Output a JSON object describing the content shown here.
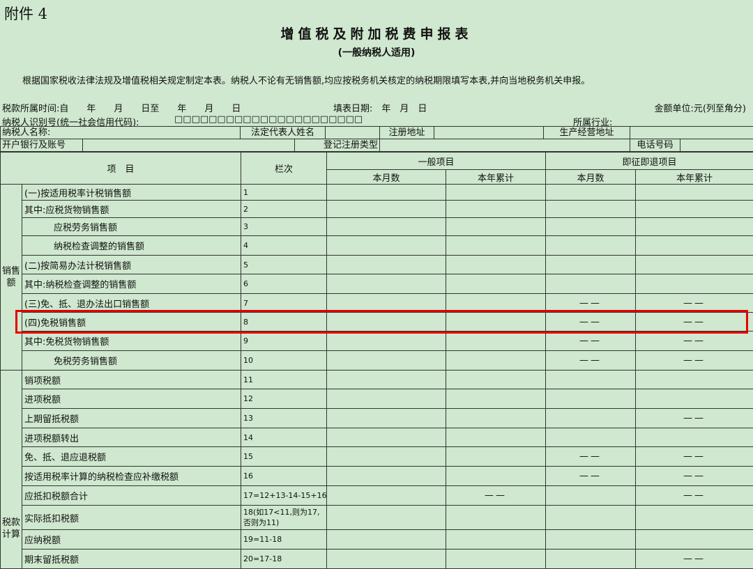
{
  "header": {
    "attachment": "附件 4",
    "title": "增值税及附加税费申报表",
    "subtitle": "(一般纳税人适用)",
    "intro": "根据国家税收法律法规及增值税相关规定制定本表。纳税人不论有无销售额,均应按税务机关核定的纳税期限填写本表,并向当地税务机关申报。"
  },
  "meta": {
    "period": "税款所属时间:自　　年　　月　　日至　　年　　月　　日",
    "fill_date": "填表日期:　年　月　日",
    "unit": "金额单位:元(列至角分)",
    "taxpayer_id": "纳税人识别号(统一社会信用代码):",
    "id_boxes": "□□□□□□□□□□□□□□□□□□□□□□",
    "industry": "所属行业:"
  },
  "info": {
    "name_label": "纳税人名称:",
    "legal_rep": "法定代表人姓名",
    "reg_address": "注册地址",
    "biz_address": "生产经营地址",
    "bank_label": "开户银行及账号",
    "reg_type": "登记注册类型",
    "phone": "电话号码"
  },
  "columns": {
    "item": "项　目",
    "seq": "栏次",
    "general": "一般项目",
    "refund": "即征即退项目",
    "month": "本月数",
    "ytd": "本年累计"
  },
  "groups": {
    "sales": "销售额",
    "tax": "税款计算"
  },
  "dash": "——",
  "rows": [
    {
      "name": "(一)按适用税率计税销售额",
      "seq": "1"
    },
    {
      "name": "其中:应税货物销售额",
      "seq": "2"
    },
    {
      "name": "应税劳务销售额",
      "seq": "3"
    },
    {
      "name": "纳税检查调整的销售额",
      "seq": "4"
    },
    {
      "name": "(二)按简易办法计税销售额",
      "seq": "5"
    },
    {
      "name": "其中:纳税检查调整的销售额",
      "seq": "6"
    },
    {
      "name": "(三)免、抵、退办法出口销售额",
      "seq": "7"
    },
    {
      "name": "(四)免税销售额",
      "seq": "8"
    },
    {
      "name": "其中:免税货物销售额",
      "seq": "9"
    },
    {
      "name": "免税劳务销售额",
      "seq": "10"
    },
    {
      "name": "销项税额",
      "seq": "11"
    },
    {
      "name": "进项税额",
      "seq": "12"
    },
    {
      "name": "上期留抵税额",
      "seq": "13"
    },
    {
      "name": "进项税额转出",
      "seq": "14"
    },
    {
      "name": "免、抵、退应退税额",
      "seq": "15"
    },
    {
      "name": "按适用税率计算的纳税检查应补缴税额",
      "seq": "16"
    },
    {
      "name": "应抵扣税额合计",
      "seq": "17=12+13-14-15+16"
    },
    {
      "name": "实际抵扣税额",
      "seq": "18(如17<11,则为17,否则为11)"
    },
    {
      "name": "应纳税额",
      "seq": "19=11-18"
    },
    {
      "name": "期末留抵税额",
      "seq": "20=17-18"
    }
  ],
  "highlight_row": "8"
}
